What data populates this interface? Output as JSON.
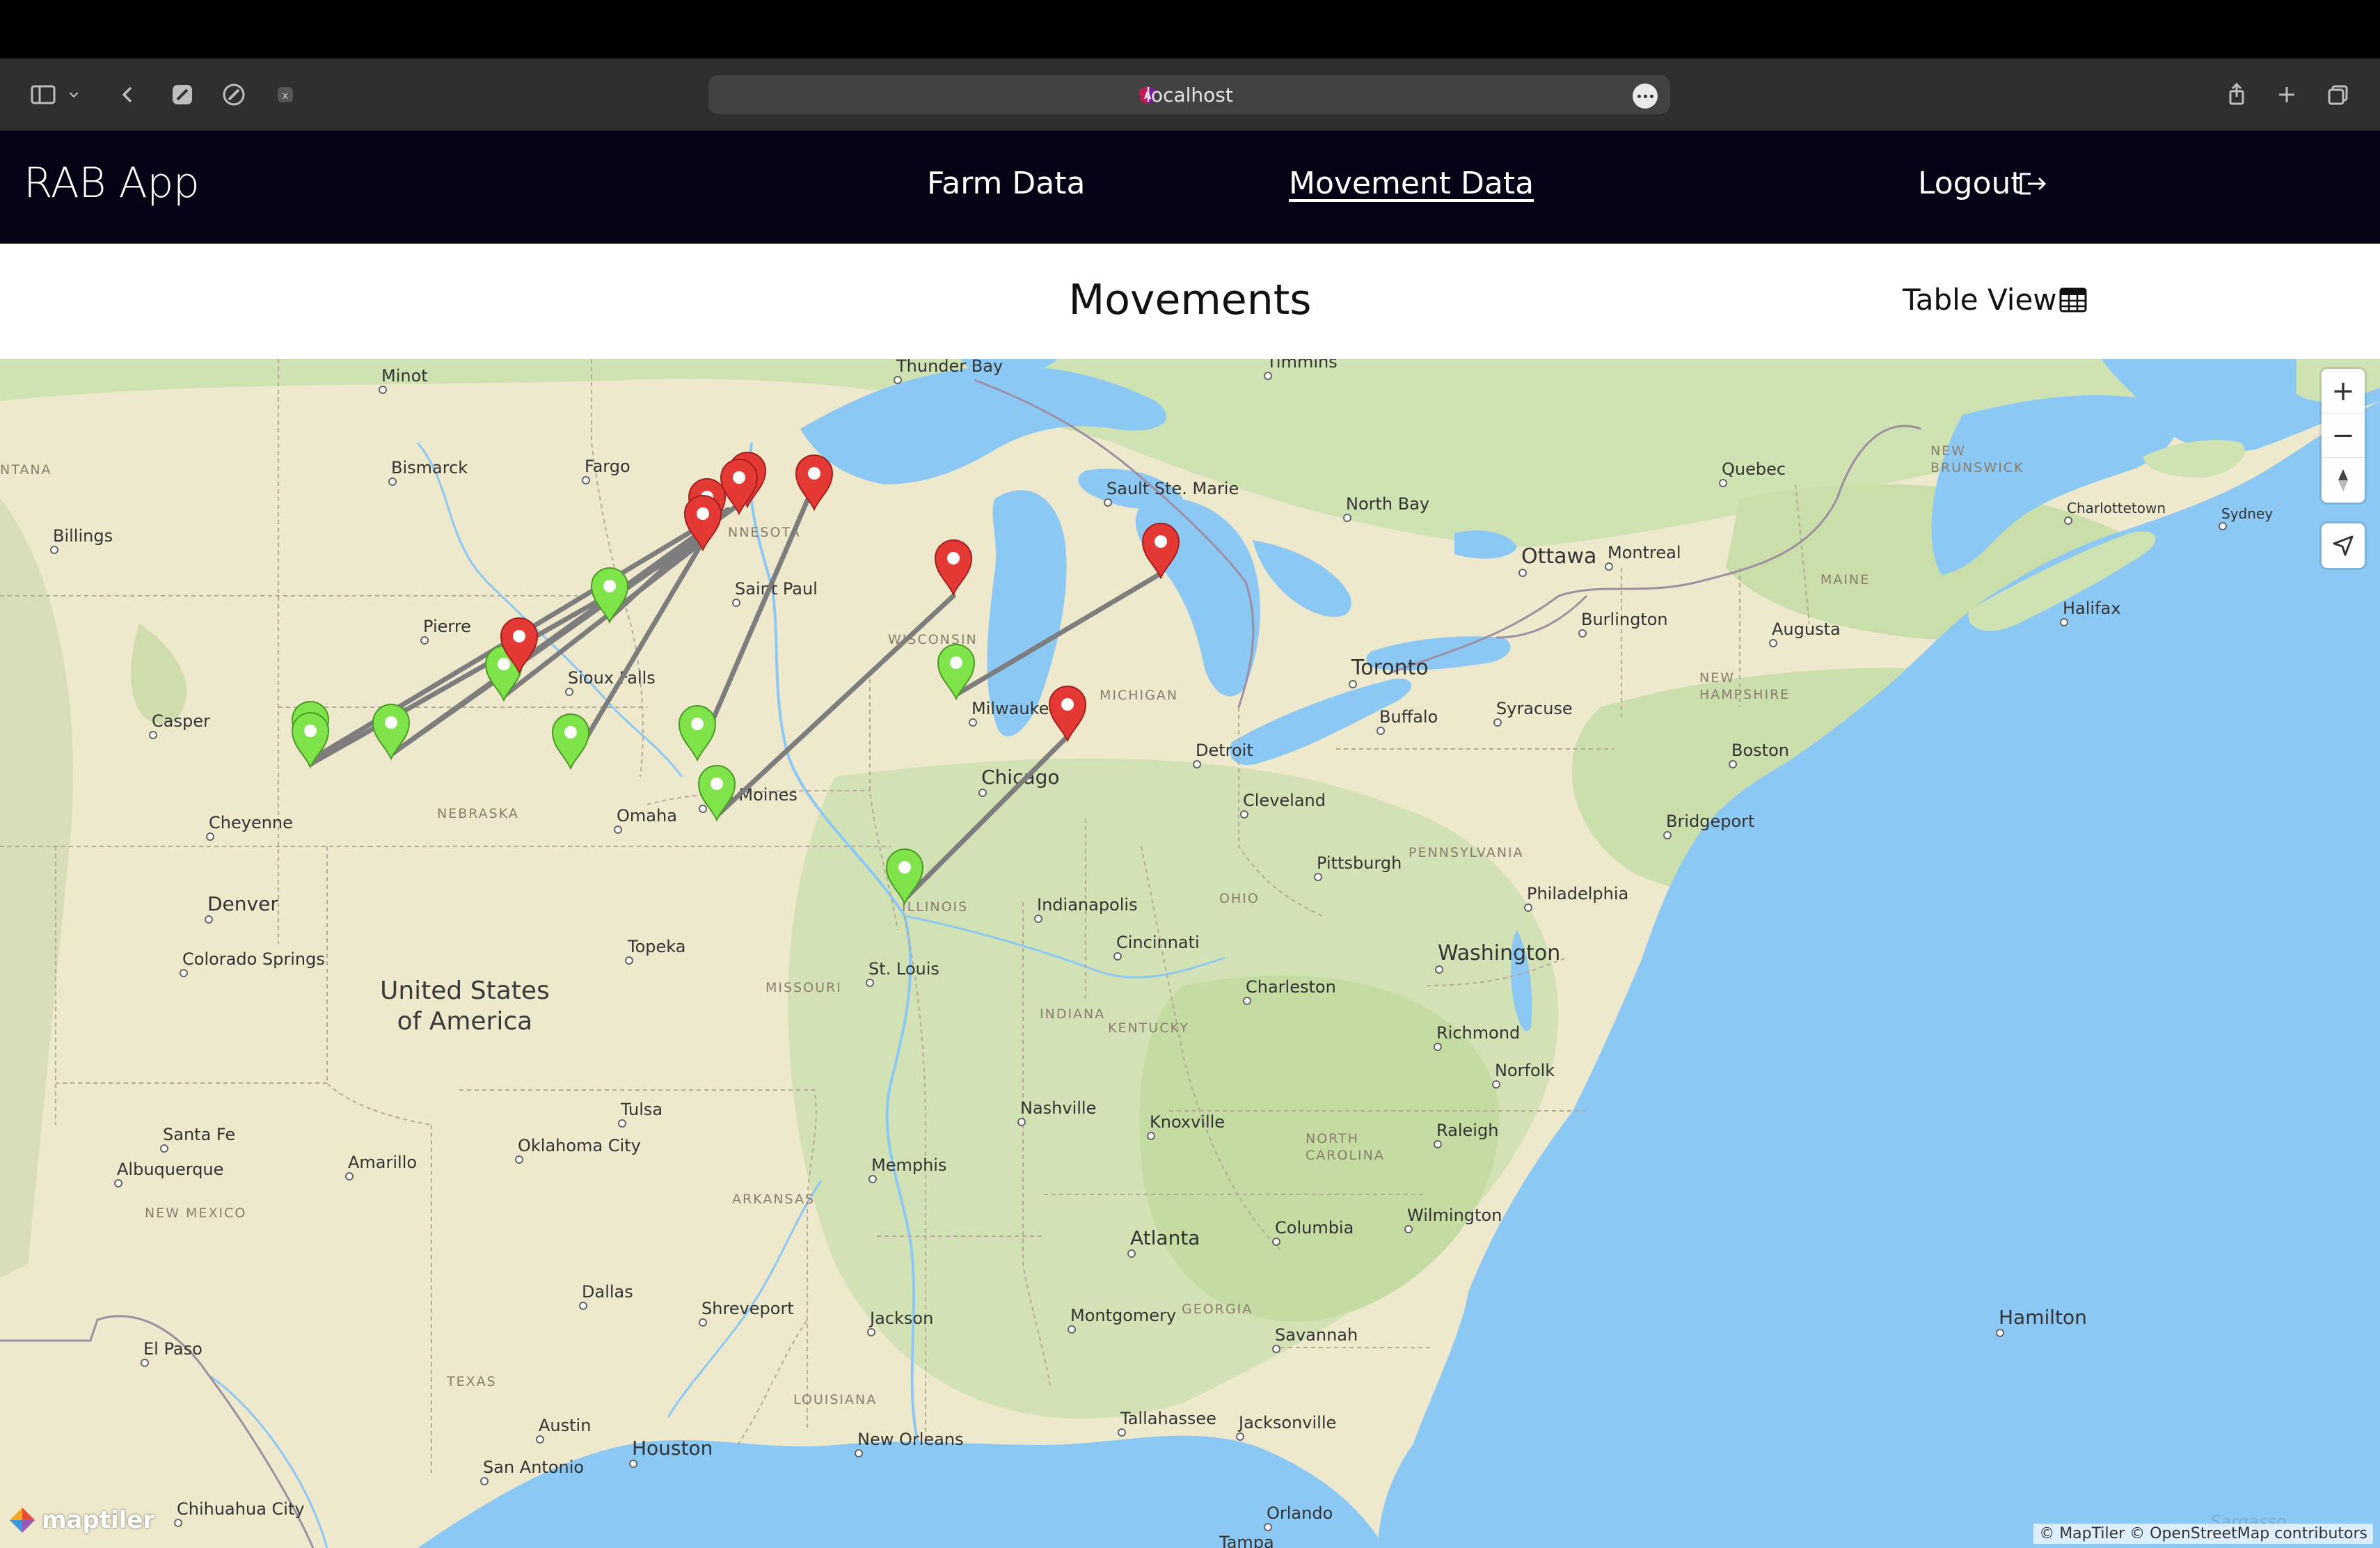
{
  "browser": {
    "url": "localhost"
  },
  "app": {
    "brand": "RAB App",
    "nav": {
      "farm_data": "Farm Data",
      "movement_data": "Movement Data",
      "logout": "Logout"
    }
  },
  "page": {
    "title": "Movements",
    "table_view": "Table View"
  },
  "map": {
    "attribution": "© MapTiler © OpenStreetMap contributors",
    "logo": "maptiler",
    "controls": {
      "zoom_in": "+",
      "zoom_out": "−"
    },
    "colors": {
      "water": "#8cc8f4",
      "land": "#f2ecd4",
      "origin_marker": "#7fe34a",
      "destination_marker": "#e53935",
      "route": "#7d7d7d"
    },
    "labels": {
      "thunder_bay": "Thunder Bay",
      "timmins": "Timmins",
      "minot": "Minot",
      "bismarck": "Bismarck",
      "fargo": "Fargo",
      "montana": "NTANA",
      "billings": "Billings",
      "pierre": "Pierre",
      "sault": "Sault Ste. Marie",
      "north_bay": "North Bay",
      "quebec": "Quebec",
      "new_brunswick": "NEW\nBRUNSWICK",
      "charlottetown": "Charlottetown",
      "sydney": "Sydney",
      "saint_paul": "Saint Paul",
      "minnesota": "NNESOTA",
      "ottawa": "Ottawa",
      "montreal": "Montreal",
      "maine": "MAINE",
      "halifax": "Halifax",
      "burlington": "Burlington",
      "augusta": "Augusta",
      "toronto": "Toronto",
      "sioux_falls": "Sioux Falls",
      "casper": "Casper",
      "wisconsin": "WISCONSIN",
      "milwaukee": "Milwaukee",
      "michigan": "MICHIGAN",
      "buffalo": "Buffalo",
      "syracuse": "Syracuse",
      "new_hampshire": "NEW\nHAMPSHIRE",
      "boston": "Boston",
      "detroit": "Detroit",
      "chicago": "Chicago",
      "cheyenne": "Cheyenne",
      "nebraska": "NEBRASKA",
      "omaha": "Omaha",
      "des_moines": "Des Moines",
      "cleveland": "Cleveland",
      "bridgeport": "Bridgeport",
      "pittsburgh": "Pittsburgh",
      "pennsylvania": "PENNSYLVANIA",
      "denver": "Denver",
      "illinois": "ILLINOIS",
      "indianapolis": "Indianapolis",
      "ohio": "OHIO",
      "philadelphia": "Philadelphia",
      "colorado_springs": "Colorado Springs",
      "topeka": "Topeka",
      "st_louis": "St. Louis",
      "cincinnati": "Cincinnati",
      "washington": "Washington",
      "usa": "United States\nof America",
      "missouri": "MISSOURI",
      "charleston": "Charleston",
      "indiana": "INDIANA",
      "kentucky": "KENTUCKY",
      "richmond": "Richmond",
      "norfolk": "Norfolk",
      "tulsa": "Tulsa",
      "nashville": "Nashville",
      "knoxville": "Knoxville",
      "santa_fe": "Santa Fe",
      "oklahoma_city": "Oklahoma City",
      "albuquerque": "Albuquerque",
      "amarillo": "Amarillo",
      "memphis": "Memphis",
      "raleigh": "Raleigh",
      "arkansas": "ARKANSAS",
      "north_carolina": "NORTH\nCAROLINA",
      "new_mexico": "NEW MEXICO",
      "atlanta": "Atlanta",
      "wilmington": "Wilmington",
      "columbia": "Columbia",
      "dallas": "Dallas",
      "shreveport": "Shreveport",
      "georgia": "GEORGIA",
      "jackson": "Jackson",
      "montgomery": "Montgomery",
      "savannah": "Savannah",
      "hamilton": "Hamilton",
      "el_paso": "El Paso",
      "texas": "TEXAS",
      "louisiana": "LOUISIANA",
      "tallahassee": "Tallahassee",
      "jacksonville": "Jacksonville",
      "austin": "Austin",
      "houston": "Houston",
      "new_orleans": "New Orleans",
      "san_antonio": "San Antonio",
      "chihuahua": "Chihuahua City",
      "orlando": "Orlando",
      "tampa": "Tampa",
      "sargasso": "Sargasso"
    }
  }
}
